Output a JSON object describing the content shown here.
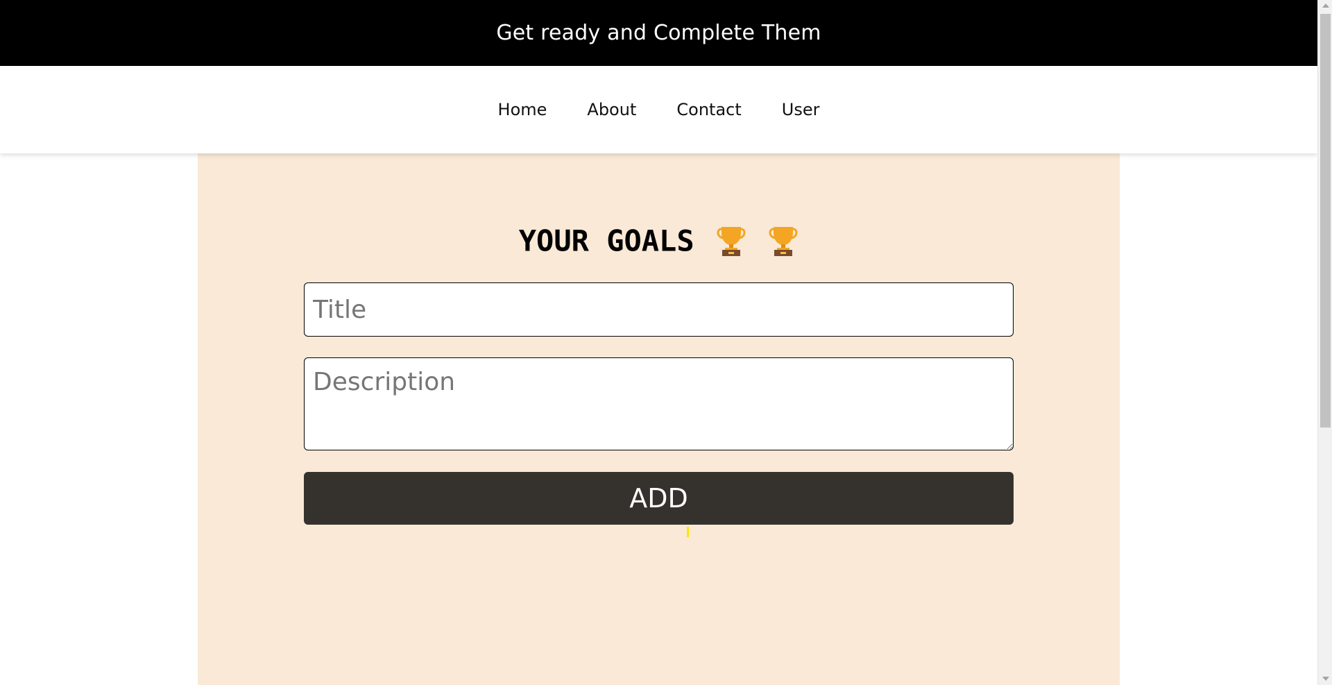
{
  "banner": {
    "text": "Get ready and Complete Them"
  },
  "nav": {
    "items": [
      {
        "label": "Home"
      },
      {
        "label": "About"
      },
      {
        "label": "Contact"
      },
      {
        "label": "User"
      }
    ]
  },
  "goals": {
    "heading": "YOUR GOALS",
    "trophy_icons": [
      "trophy-icon",
      "trophy-icon"
    ],
    "title_placeholder": "Title",
    "title_value": "",
    "description_placeholder": "Description",
    "description_value": "",
    "add_label": "ADD"
  },
  "colors": {
    "banner_bg": "#000000",
    "panel_bg": "#f9e9d6",
    "button_bg": "#35322d",
    "trophy_gold": "#f3a523",
    "trophy_base": "#7a4a2c"
  }
}
